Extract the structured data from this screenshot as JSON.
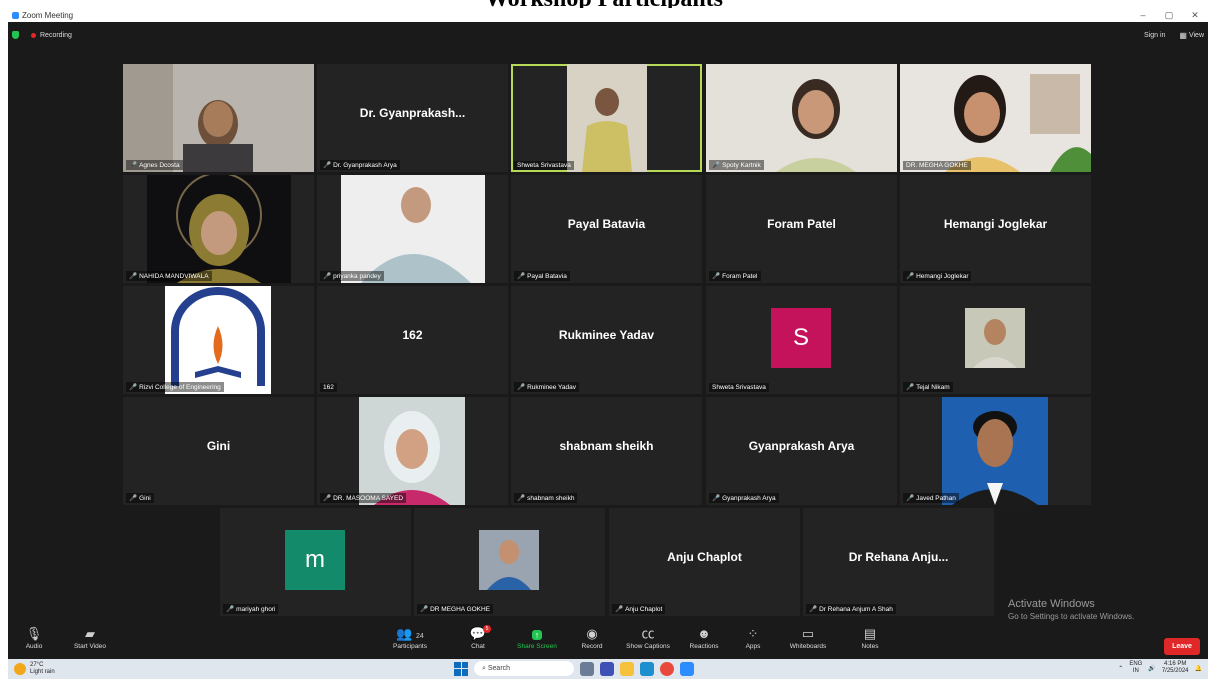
{
  "page_heading": "Workshop Participants",
  "window": {
    "title": "Zoom Meeting",
    "controls": [
      "–",
      "▢",
      "✕"
    ]
  },
  "topbar": {
    "recording": "Recording",
    "sign_in": "Sign in",
    "view": "View"
  },
  "tiles": [
    {
      "big": "",
      "label": "Agnes Dcosta",
      "muted": true,
      "kind": "photo"
    },
    {
      "big": "Dr. Gyanprakash...",
      "label": "Dr. Gyanprakash Arya",
      "muted": true,
      "kind": "name"
    },
    {
      "big": "",
      "label": "Shweta Srivastava",
      "muted": false,
      "kind": "photo",
      "speaking": true
    },
    {
      "big": "",
      "label": "Spoty Kartnik",
      "muted": true,
      "kind": "photo"
    },
    {
      "big": "",
      "label": "DR. MEGHA GOKHE",
      "muted": false,
      "kind": "photo"
    },
    {
      "big": "",
      "label": "NAHIDA MANDVIWALA",
      "muted": true,
      "kind": "photo"
    },
    {
      "big": "",
      "label": "priyanka pandey",
      "muted": true,
      "kind": "photo"
    },
    {
      "big": "Payal Batavia",
      "label": "Payal Batavia",
      "muted": true,
      "kind": "name"
    },
    {
      "big": "Foram Patel",
      "label": "Foram Patel",
      "muted": true,
      "kind": "name"
    },
    {
      "big": "Hemangi Joglekar",
      "label": "Hemangi Joglekar",
      "muted": true,
      "kind": "name"
    },
    {
      "big": "",
      "label": "Rizvi College of Engineering",
      "muted": true,
      "kind": "logo"
    },
    {
      "big": "162",
      "label": "162",
      "muted": false,
      "kind": "name"
    },
    {
      "big": "Rukminee Yadav",
      "label": "Rukminee Yadav",
      "muted": true,
      "kind": "name"
    },
    {
      "big": "S",
      "label": "Shweta Srivastava",
      "muted": false,
      "kind": "letter",
      "color": "#c4135a"
    },
    {
      "big": "",
      "label": "Tejal Nikam",
      "muted": true,
      "kind": "smallphoto"
    },
    {
      "big": "Gini",
      "label": "Gini",
      "muted": true,
      "kind": "name"
    },
    {
      "big": "",
      "label": "DR. MASOOMA SAYED",
      "muted": true,
      "kind": "photo"
    },
    {
      "big": "shabnam sheikh",
      "label": "shabnam sheikh",
      "muted": true,
      "kind": "name"
    },
    {
      "big": "Gyanprakash Arya",
      "label": "Gyanprakash Arya",
      "muted": true,
      "kind": "name"
    },
    {
      "big": "",
      "label": "Javed Pathan",
      "muted": true,
      "kind": "photo"
    },
    {
      "big": "m",
      "label": "mariyah ghori",
      "muted": true,
      "kind": "letter",
      "color": "#138a6a"
    },
    {
      "big": "",
      "label": "DR MEGHA GOKHE",
      "muted": true,
      "kind": "smallphoto"
    },
    {
      "big": "Anju Chaplot",
      "label": "Anju Chaplot",
      "muted": true,
      "kind": "name"
    },
    {
      "big": "Dr Rehana Anju...",
      "label": "Dr Rehana Anjum A Shah",
      "muted": true,
      "kind": "name"
    }
  ],
  "watermark": {
    "line1": "Activate Windows",
    "line2": "Go to Settings to activate Windows."
  },
  "toolbar": {
    "audio": "Audio",
    "start_video": "Start Video",
    "participants": "Participants",
    "participants_count": "24",
    "chat": "Chat",
    "chat_badge": "5",
    "share_screen": "Share Screen",
    "record": "Record",
    "show_captions": "Show Captions",
    "reactions": "Reactions",
    "apps": "Apps",
    "whiteboards": "Whiteboards",
    "notes": "Notes",
    "leave": "Leave"
  },
  "taskbar": {
    "temperature": "27°C",
    "weather": "Light rain",
    "weather_badge": "1",
    "search": "Search",
    "lang": "ENG",
    "region": "IN",
    "time": "4:16 PM",
    "date": "7/25/2024"
  },
  "colors": {
    "accent_green": "#23c552",
    "leave_red": "#e02828",
    "speaker_outline": "#b8d85a"
  }
}
